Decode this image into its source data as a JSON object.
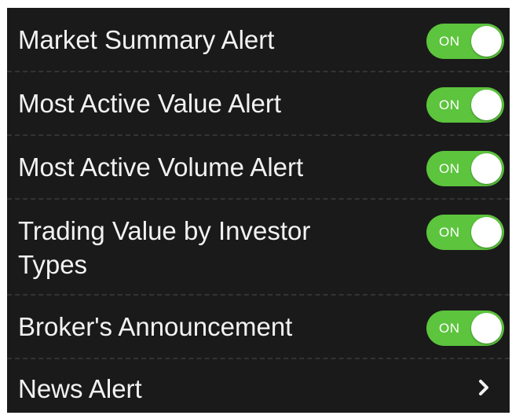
{
  "settings": {
    "items": [
      {
        "label": "Market Summary Alert",
        "toggle": "ON"
      },
      {
        "label": "Most Active Value Alert",
        "toggle": "ON"
      },
      {
        "label": "Most Active Volume Alert",
        "toggle": "ON"
      },
      {
        "label": "Trading Value by Investor Types",
        "toggle": "ON"
      },
      {
        "label": "Broker's Announcement",
        "toggle": "ON"
      },
      {
        "label": "News Alert",
        "icon": "chevron-right-icon"
      }
    ]
  },
  "colors": {
    "background": "#1a1a1a",
    "text": "#f2f2f2",
    "toggle_on": "#5cc43d",
    "divider": "#333333"
  }
}
